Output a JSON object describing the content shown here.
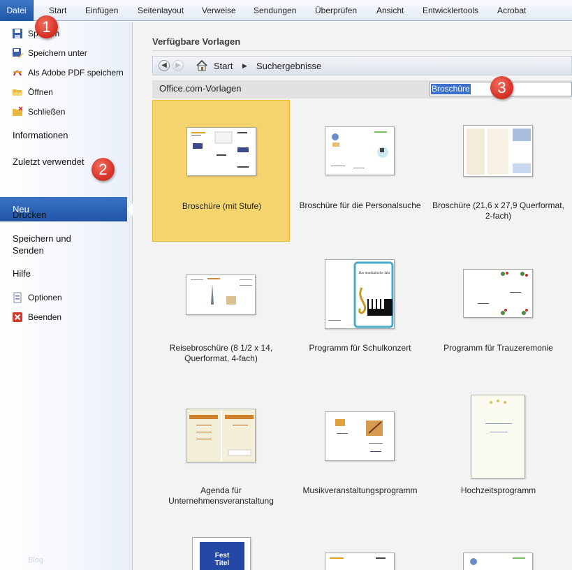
{
  "ribbon": {
    "tabs": [
      "Datei",
      "Start",
      "Einfügen",
      "Seitenlayout",
      "Verweise",
      "Sendungen",
      "Überprüfen",
      "Ansicht",
      "Entwicklertools",
      "Acrobat"
    ]
  },
  "left_menu": {
    "save": "Speichern",
    "save_visible": "Sp      rn",
    "save_as": "Speichern unter",
    "save_pdf": "Als Adobe PDF speichern",
    "open": "Öffnen",
    "close": "Schließen",
    "info": "Informationen",
    "recent": "Zuletzt verwendet",
    "new": "Neu",
    "print": "Drucken",
    "save_send": "Speichern und Senden",
    "help": "Hilfe",
    "options": "Optionen",
    "exit": "Beenden",
    "ghost_text": "Blog"
  },
  "main": {
    "section_title": "Verfügbare Vorlagen",
    "breadcrumb": [
      "Start",
      "Suchergebnisse"
    ],
    "source_label": "Office.com-Vorlagen",
    "search_value": "Broschüre",
    "templates": [
      "Broschüre (mit Stufe)",
      "Broschüre für die Personalsuche",
      "Broschüre (21,6 x 27,9 Querformat, 2-fach)",
      "Reisebroschüre (8 1/2 x 14, Querformat, 4-fach)",
      "Programm für Schulkonzert",
      "Programm für Trauzeremonie",
      "Agenda für Unternehmensveranstaltung",
      "Musikveranstaltungsprogramm",
      "Hochzeitsprogramm"
    ],
    "thumb_texts": {
      "concert_title": "Das musikalische Jahr",
      "fest_titel_1": "Fest",
      "fest_titel_2": "Titel"
    }
  },
  "callouts": [
    "1",
    "2",
    "3"
  ],
  "colors": {
    "accent": "#2a5db0",
    "selected_tile": "#f6d46d",
    "callout": "#d9342a"
  }
}
